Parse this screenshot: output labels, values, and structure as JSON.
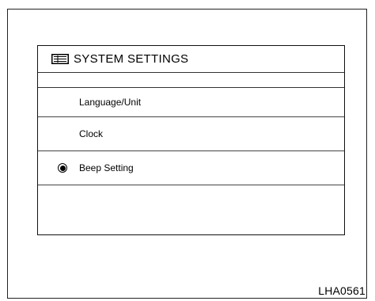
{
  "screen": {
    "title": "SYSTEM SETTINGS",
    "title_icon": "settings-list-icon",
    "menu_items": [
      {
        "label": "Language/Unit",
        "selected": false
      },
      {
        "label": "Clock",
        "selected": false
      },
      {
        "label": "Beep Setting",
        "selected": true
      }
    ]
  },
  "figure_id": "LHA0561"
}
